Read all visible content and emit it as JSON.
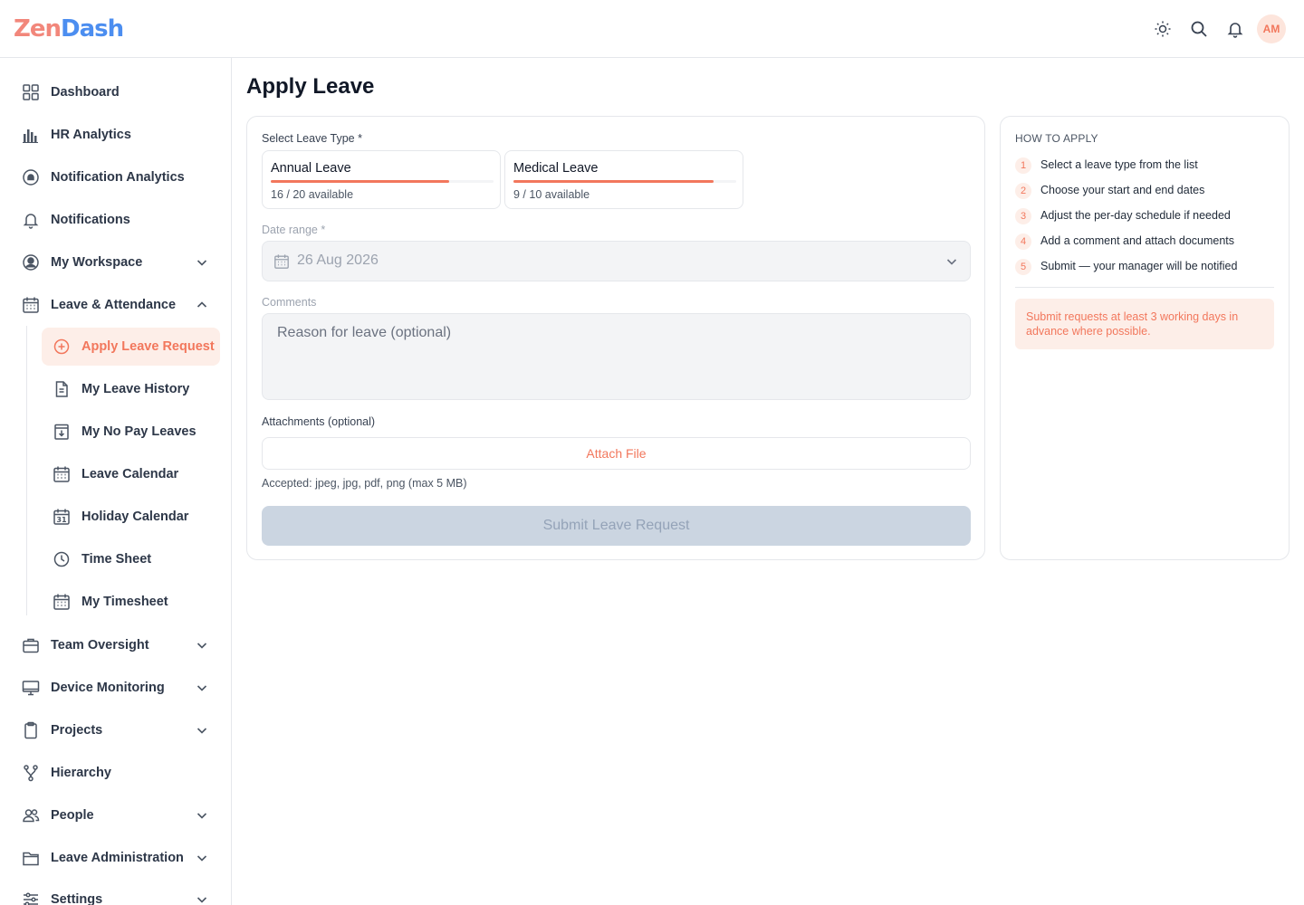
{
  "app": {
    "logo_part1": "Zen",
    "logo_part2": "Dash",
    "avatar_initials": "AM",
    "accent_color": "#f2775c"
  },
  "topbar": {
    "icons": [
      "sun-icon",
      "search-icon",
      "bell-icon"
    ]
  },
  "sidebar": {
    "items": [
      {
        "label": "Dashboard",
        "icon": "grid-icon"
      },
      {
        "label": "HR Analytics",
        "icon": "bar-chart-icon"
      },
      {
        "label": "Notification Analytics",
        "icon": "notification-circle-icon"
      },
      {
        "label": "Notifications",
        "icon": "bell-icon"
      },
      {
        "label": "My Workspace",
        "icon": "user-circle-icon",
        "expandable": true
      },
      {
        "label": "Leave & Attendance",
        "icon": "calendar-icon",
        "expanded": true
      },
      {
        "label": "Team Oversight",
        "icon": "briefcase-icon",
        "expandable": true
      },
      {
        "label": "Device Monitoring",
        "icon": "monitor-icon",
        "expandable": true
      },
      {
        "label": "Projects",
        "icon": "clipboard-icon",
        "expandable": true
      },
      {
        "label": "Hierarchy",
        "icon": "branch-icon"
      },
      {
        "label": "People",
        "icon": "users-icon",
        "expandable": true
      },
      {
        "label": "Leave Administration",
        "icon": "folder-icon",
        "expandable": true
      },
      {
        "label": "Settings",
        "icon": "sliders-icon",
        "expandable": true
      }
    ],
    "sub_items": [
      {
        "label": "Apply Leave Request",
        "icon": "plus-circle-icon",
        "active": true
      },
      {
        "label": "My Leave History",
        "icon": "document-icon"
      },
      {
        "label": "My No Pay Leaves",
        "icon": "archive-icon"
      },
      {
        "label": "Leave Calendar",
        "icon": "calendar-icon"
      },
      {
        "label": "Holiday Calendar",
        "icon": "calendar-31-icon"
      },
      {
        "label": "Time Sheet",
        "icon": "clock-icon"
      },
      {
        "label": "My Timesheet",
        "icon": "calendar-icon"
      }
    ]
  },
  "page": {
    "title": "Apply Leave"
  },
  "form": {
    "leave_type_label": "Select Leave Type *",
    "leave_types": [
      {
        "name": "Annual Leave",
        "available_text": "16 / 20 available",
        "available_fraction": 0.8
      },
      {
        "name": "Medical Leave",
        "available_text": "9 / 10 available",
        "available_fraction": 0.9
      }
    ],
    "date_range_label": "Date range *",
    "date_range_value": "26 Aug 2026",
    "comments_label": "Comments",
    "comments_placeholder": "Reason for leave (optional)",
    "attachments_label": "Attachments (optional)",
    "attach_button": "Attach File",
    "accepted_text": "Accepted: jpeg, jpg, pdf, png (max 5 MB)",
    "submit_button": "Submit Leave Request"
  },
  "help": {
    "title": "HOW TO APPLY",
    "steps": [
      {
        "num": "1",
        "text": "Select a leave type from the list"
      },
      {
        "num": "2",
        "text": "Choose your start and end dates"
      },
      {
        "num": "3",
        "text": "Adjust the per-day schedule if needed"
      },
      {
        "num": "4",
        "text": "Add a comment and attach documents"
      },
      {
        "num": "5",
        "text": "Submit — your manager will be notified"
      }
    ],
    "note": "Submit requests at least 3 working days in advance where possible."
  }
}
